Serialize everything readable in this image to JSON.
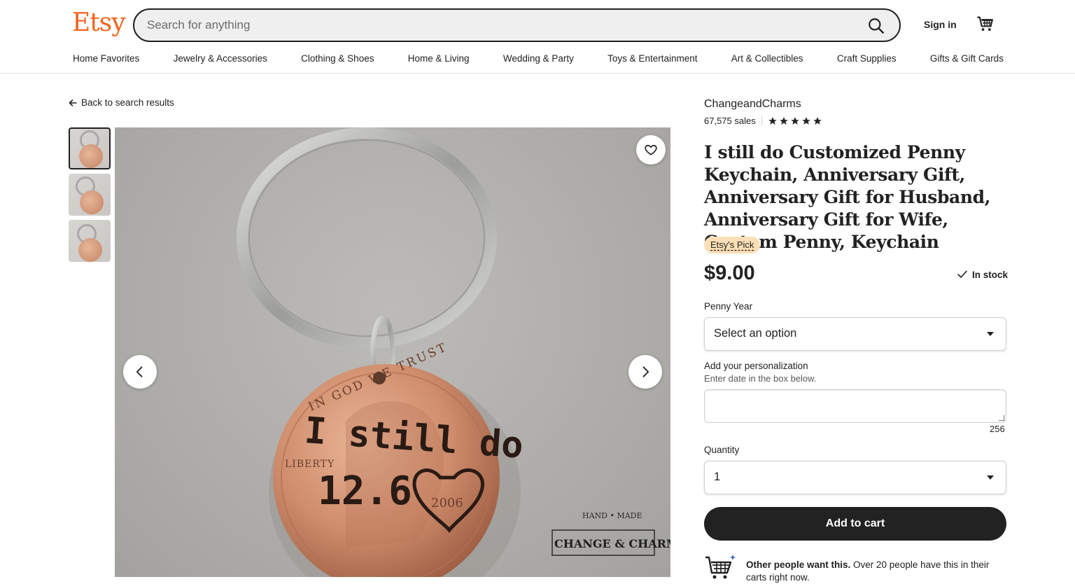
{
  "header": {
    "logo": "Etsy",
    "search_placeholder": "Search for anything",
    "signin": "Sign in"
  },
  "nav": [
    "Home Favorites",
    "Jewelry & Accessories",
    "Clothing & Shoes",
    "Home & Living",
    "Wedding & Party",
    "Toys & Entertainment",
    "Art & Collectibles",
    "Craft Supplies",
    "Gifts & Gift Cards"
  ],
  "back_link": "Back to search results",
  "gallery": {
    "thumbnails": 3,
    "active": 0
  },
  "product": {
    "shop_name": "ChangeandCharms",
    "sales": "67,575 sales",
    "rating_stars": 5,
    "title": "I still do Customized Penny Keychain, Anniversary Gift, Anniversary Gift for Husband, Anniversary Gift for Wife, Custom Penny, Keychain",
    "badge": "Etsy's Pick",
    "price": "$9.00",
    "stock": "In stock"
  },
  "options": {
    "penny_year_label": "Penny Year",
    "penny_year_value": "Select an option",
    "personalization_label": "Add your personalization",
    "personalization_hint": "Enter date in the box below.",
    "personalization_value": "",
    "char_count": "256",
    "quantity_label": "Quantity",
    "quantity_value": "1"
  },
  "add_to_cart": "Add to cart",
  "demand": {
    "bold": "Other people want this.",
    "text": "Over 20 people have this in their carts right now."
  },
  "image_text": {
    "coin_line1": "I still do",
    "coin_line2": "12.6",
    "motto": "IN GOD WE TRUST",
    "liberty": "LIBERTY",
    "year": "2006",
    "brand_top": "HAND • MADE",
    "brand": "CHANGE & CHARMS"
  },
  "colors": {
    "brand": "#f1641e",
    "button": "#222222",
    "badge": "#fddfb6"
  }
}
